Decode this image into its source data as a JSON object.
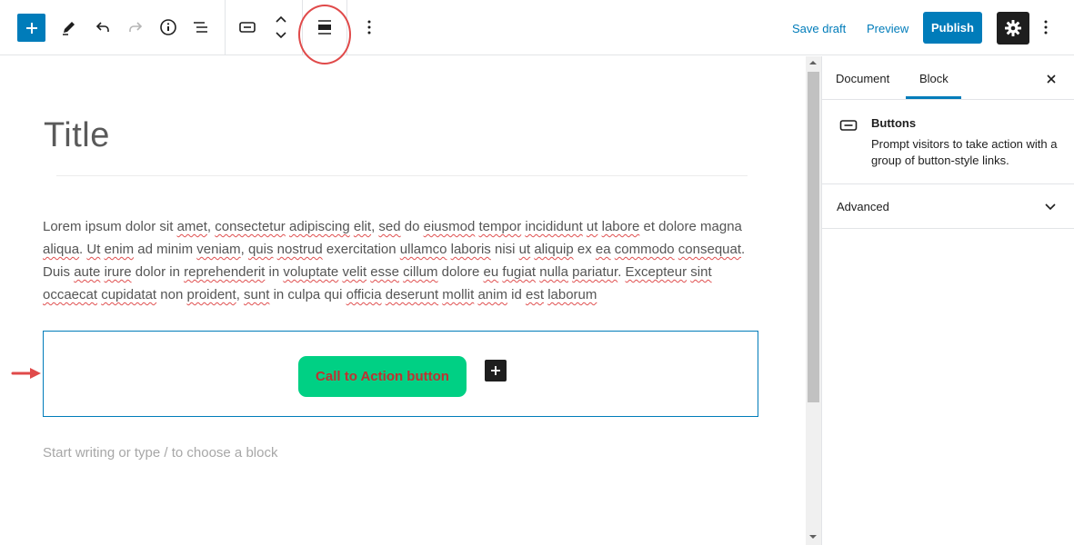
{
  "toolbar": {
    "add_block": "add-block",
    "tools": "pencil-icon",
    "undo": "undo-icon",
    "redo": "redo-icon",
    "info": "info-icon",
    "outline": "list-view-icon",
    "block_type": "buttons-block-icon",
    "mover": "move-up-down-icon",
    "align": "align-icon",
    "more": "more-vertical-icon",
    "save_draft": "Save draft",
    "preview": "Preview",
    "publish": "Publish",
    "settings": "gear-icon",
    "options": "more-vertical-icon"
  },
  "editor": {
    "title": "Title",
    "paragraph": [
      {
        "t": "Lorem ipsum dolor sit ",
        "s": false
      },
      {
        "t": "amet",
        "s": true
      },
      {
        "t": ", ",
        "s": false
      },
      {
        "t": "consectetur",
        "s": true
      },
      {
        "t": " ",
        "s": false
      },
      {
        "t": "adipiscing",
        "s": true
      },
      {
        "t": " ",
        "s": false
      },
      {
        "t": "elit",
        "s": true
      },
      {
        "t": ", ",
        "s": false
      },
      {
        "t": "sed",
        "s": true
      },
      {
        "t": " do ",
        "s": false
      },
      {
        "t": "eiusmod",
        "s": true
      },
      {
        "t": " ",
        "s": false
      },
      {
        "t": "tempor",
        "s": true
      },
      {
        "t": " ",
        "s": false
      },
      {
        "t": "incididunt",
        "s": true
      },
      {
        "t": " ",
        "s": false
      },
      {
        "t": "ut",
        "s": true
      },
      {
        "t": " ",
        "s": false
      },
      {
        "t": "labore",
        "s": true
      },
      {
        "t": " et dolore magna ",
        "s": false
      },
      {
        "t": "aliqua",
        "s": true
      },
      {
        "t": ". ",
        "s": false
      },
      {
        "t": "Ut",
        "s": true
      },
      {
        "t": " ",
        "s": false
      },
      {
        "t": "enim",
        "s": true
      },
      {
        "t": " ad minim ",
        "s": false
      },
      {
        "t": "veniam",
        "s": true
      },
      {
        "t": ", ",
        "s": false
      },
      {
        "t": "quis",
        "s": true
      },
      {
        "t": " ",
        "s": false
      },
      {
        "t": "nostrud",
        "s": true
      },
      {
        "t": " exercitation ",
        "s": false
      },
      {
        "t": "ullamco",
        "s": true
      },
      {
        "t": " ",
        "s": false
      },
      {
        "t": "laboris",
        "s": true
      },
      {
        "t": " nisi ",
        "s": false
      },
      {
        "t": "ut",
        "s": true
      },
      {
        "t": " ",
        "s": false
      },
      {
        "t": "aliquip",
        "s": true
      },
      {
        "t": " ex ",
        "s": false
      },
      {
        "t": "ea",
        "s": true
      },
      {
        "t": " ",
        "s": false
      },
      {
        "t": "commodo",
        "s": true
      },
      {
        "t": " ",
        "s": false
      },
      {
        "t": "consequat",
        "s": true
      },
      {
        "t": ". ",
        "s": false
      },
      {
        "t": "Duis ",
        "s": false
      },
      {
        "t": "aute",
        "s": true
      },
      {
        "t": " ",
        "s": false
      },
      {
        "t": "irure",
        "s": true
      },
      {
        "t": " dolor in ",
        "s": false
      },
      {
        "t": "reprehenderit",
        "s": true
      },
      {
        "t": " in ",
        "s": false
      },
      {
        "t": "voluptate",
        "s": true
      },
      {
        "t": " ",
        "s": false
      },
      {
        "t": "velit",
        "s": true
      },
      {
        "t": " ",
        "s": false
      },
      {
        "t": "esse",
        "s": true
      },
      {
        "t": " ",
        "s": false
      },
      {
        "t": "cillum",
        "s": true
      },
      {
        "t": " dolore ",
        "s": false
      },
      {
        "t": "eu",
        "s": true
      },
      {
        "t": " ",
        "s": false
      },
      {
        "t": "fugiat",
        "s": true
      },
      {
        "t": " ",
        "s": false
      },
      {
        "t": "nulla",
        "s": true
      },
      {
        "t": " ",
        "s": false
      },
      {
        "t": "pariatur",
        "s": true
      },
      {
        "t": ". ",
        "s": false
      },
      {
        "t": "Excepteur",
        "s": true
      },
      {
        "t": " ",
        "s": false
      },
      {
        "t": "sint",
        "s": true
      },
      {
        "t": " ",
        "s": false
      },
      {
        "t": "occaecat",
        "s": true
      },
      {
        "t": " ",
        "s": false
      },
      {
        "t": "cupidatat",
        "s": true
      },
      {
        "t": " non ",
        "s": false
      },
      {
        "t": "proident",
        "s": true
      },
      {
        "t": ", ",
        "s": false
      },
      {
        "t": "sunt",
        "s": true
      },
      {
        "t": " in culpa qui ",
        "s": false
      },
      {
        "t": "officia",
        "s": true
      },
      {
        "t": " ",
        "s": false
      },
      {
        "t": "deserunt",
        "s": true
      },
      {
        "t": " ",
        "s": false
      },
      {
        "t": "mollit",
        "s": true
      },
      {
        "t": " ",
        "s": false
      },
      {
        "t": "anim",
        "s": true
      },
      {
        "t": " id ",
        "s": false
      },
      {
        "t": "est",
        "s": true
      },
      {
        "t": " ",
        "s": false
      },
      {
        "t": "laborum",
        "s": true
      }
    ],
    "cta_label": "Call to Action button",
    "placeholder": "Start writing or type / to choose a block"
  },
  "sidebar": {
    "tabs": [
      "Document",
      "Block"
    ],
    "active_tab": "Block",
    "block_title": "Buttons",
    "block_description": "Prompt visitors to take action with a group of button-style links.",
    "advanced": "Advanced"
  },
  "colors": {
    "accent": "#007cba",
    "cta_bg": "#00d084",
    "cta_text": "#c03030",
    "annotation": "#e04a4a"
  }
}
